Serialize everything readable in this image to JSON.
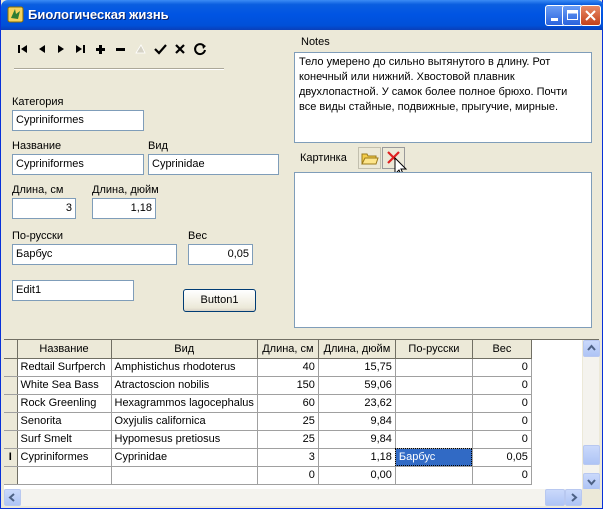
{
  "window": {
    "title": "Биологическая жизнь",
    "buttons": [
      "minimize",
      "maximize",
      "close"
    ]
  },
  "navigator": {
    "buttons": [
      "first",
      "prior",
      "next",
      "last",
      "insert",
      "delete",
      "edit",
      "post",
      "cancel",
      "refresh"
    ]
  },
  "fields": {
    "category_label": "Категория",
    "category_value": "Cypriniformes",
    "name_label": "Название",
    "name_value": "Cypriniformes",
    "species_label": "Вид",
    "species_value": "Cyprinidae",
    "length_cm_label": "Длина, см",
    "length_cm_value": "3",
    "length_in_label": "Длина, дюйм",
    "length_in_value": "1,18",
    "russian_label": "По-русски",
    "russian_value": "Барбус",
    "weight_label": "Вес",
    "weight_value": "0,05",
    "edit1_value": "Edit1",
    "button1_label": "Button1"
  },
  "notes": {
    "label": "Notes",
    "text": "Тело умерено до сильно вытянутого в длину. Рот конечный или нижний. Хвостовой плавник двухлопастной. У самок более полное брюхо. Почти все виды стайные, подвижные, прыгучие, мирные."
  },
  "picture": {
    "label": "Картинка",
    "open_icon": "folder-icon",
    "clear_icon": "red-x-icon"
  },
  "grid": {
    "columns": [
      "Название",
      "Вид",
      "Длина, см",
      "Длина, дюйм",
      "По-русски",
      "Вес"
    ],
    "rows": [
      [
        "Redtail Surfperch",
        "Amphistichus rhodoterus",
        "40",
        "15,75",
        "",
        "0"
      ],
      [
        "White Sea Bass",
        "Atractoscion nobilis",
        "150",
        "59,06",
        "",
        "0"
      ],
      [
        "Rock Greenling",
        "Hexagrammos lagocephalus",
        "60",
        "23,62",
        "",
        "0"
      ],
      [
        "Senorita",
        "Oxyjulis californica",
        "25",
        "9,84",
        "",
        "0"
      ],
      [
        "Surf Smelt",
        "Hypomesus pretiosus",
        "25",
        "9,84",
        "",
        "0"
      ],
      [
        "Cypriniformes",
        "Cyprinidae",
        "3",
        "1,18",
        "Барбус",
        "0,05"
      ],
      [
        "",
        "",
        "0",
        "0,00",
        "",
        "0"
      ]
    ],
    "current_row": 5,
    "current_row_indicator": "I"
  }
}
